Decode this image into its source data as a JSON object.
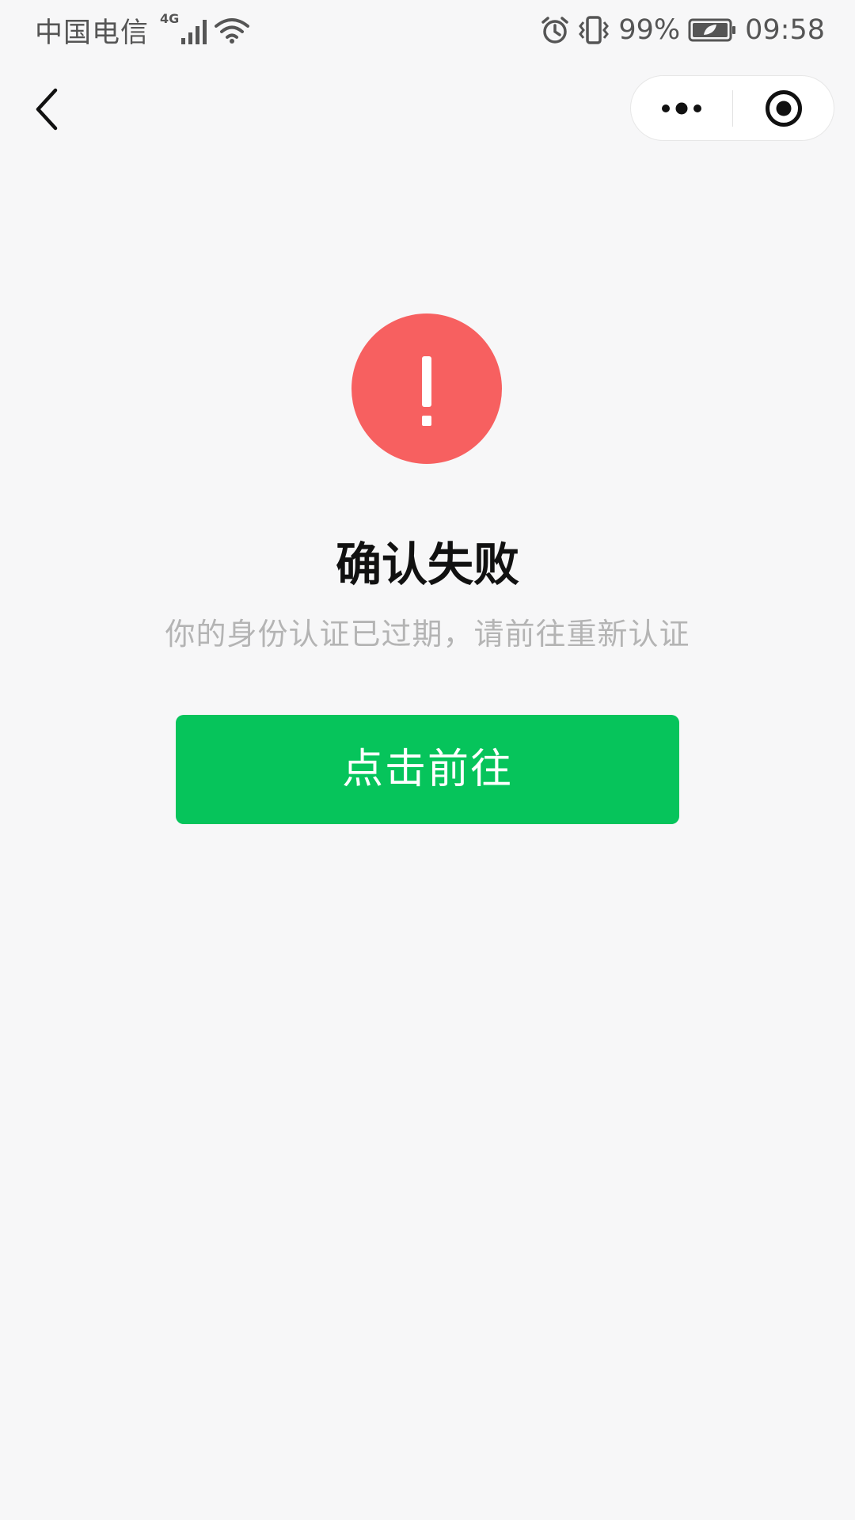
{
  "status_bar": {
    "carrier": "中国电信",
    "network_type": "4G",
    "battery_percent": "99%",
    "time": "09:58",
    "icons": [
      "signal-icon",
      "wifi-icon",
      "alarm-icon",
      "vibrate-icon",
      "battery-icon"
    ]
  },
  "nav": {
    "back_icon": "chevron-left-icon",
    "more_icon": "more-dots-icon",
    "close_icon": "target-close-icon"
  },
  "result": {
    "icon": "warning-icon",
    "icon_color": "#f76060",
    "title": "确认失败",
    "message": "你的身份认证已过期，请前往重新认证",
    "button_label": "点击前往",
    "button_color": "#06c45b"
  }
}
